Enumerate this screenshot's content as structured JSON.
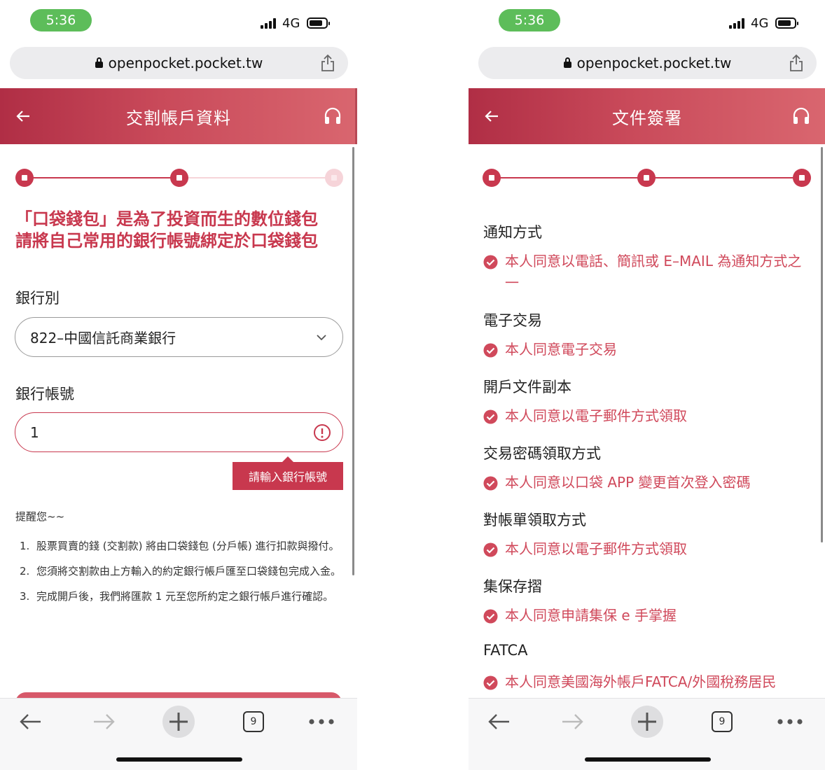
{
  "status_bar": {
    "time": "5:36",
    "network": "4G"
  },
  "browser": {
    "url": "openpocket.pocket.tw",
    "tab_count": "9"
  },
  "colors": {
    "brand": "#c8384e",
    "status_green": "#5dbd5a",
    "header_start": "#b02e45",
    "header_end": "#d9666f"
  },
  "left": {
    "title": "交割帳戶資料",
    "headline_line1": "「口袋錢包」是為了投資而生的數位錢包",
    "headline_line2": "請將自己常用的銀行帳號綁定於口袋錢包",
    "bank_label": "銀行別",
    "bank_value": "822–中國信託商業銀行",
    "account_label": "銀行帳號",
    "account_value": "1",
    "error_tooltip": "請輸入銀行帳號",
    "reminder_title": "提醒您~~",
    "notes": [
      {
        "num": "1.",
        "text": "股票買賣的錢 (交割款) 將由口袋錢包 (分戶帳) 進行扣款與撥付。"
      },
      {
        "num": "2.",
        "text": "您須將交割款由上方輸入的約定銀行帳戶匯至口袋錢包完成入金。"
      },
      {
        "num": "3.",
        "text": "完成開戶後，我們將匯款 1 元至您所約定之銀行帳戶進行確認。"
      }
    ]
  },
  "right": {
    "title": "文件簽署",
    "sections": [
      {
        "label": "通知方式",
        "consent": "本人同意以電話、簡訊或 E–MAIL 為通知方式之一"
      },
      {
        "label": "電子交易",
        "consent": "本人同意電子交易"
      },
      {
        "label": "開戶文件副本",
        "consent": "本人同意以電子郵件方式領取"
      },
      {
        "label": "交易密碼領取方式",
        "consent": "本人同意以口袋 APP 變更首次登入密碼"
      },
      {
        "label": "對帳單領取方式",
        "consent": "本人同意以電子郵件方式領取"
      },
      {
        "label": "集保存摺",
        "consent": "本人同意申請集保 e 手掌握"
      },
      {
        "label": "FATCA",
        "consent": "本人同意美國海外帳戶FATCA/外國稅務居民"
      }
    ]
  }
}
